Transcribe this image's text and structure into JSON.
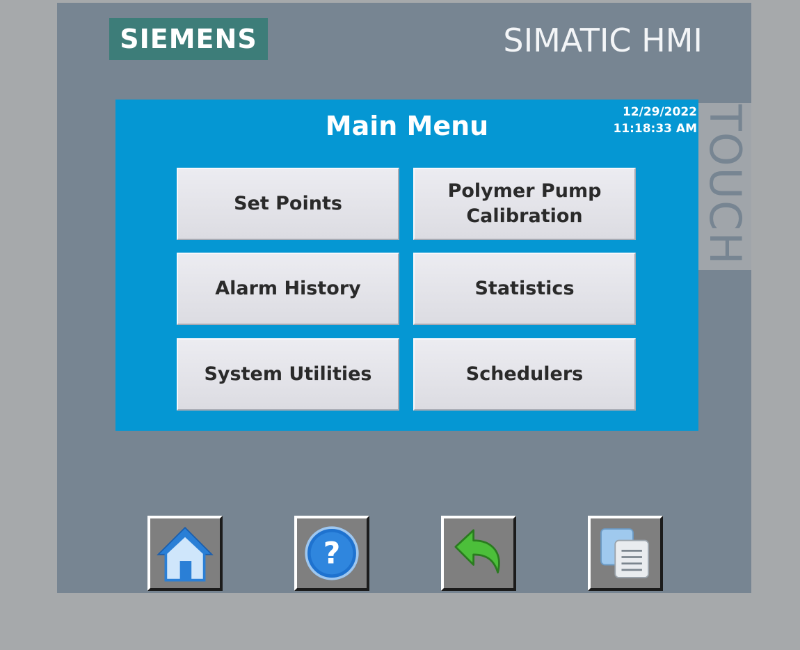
{
  "device": {
    "brand": "SIEMENS",
    "model": "SIMATIC HMI",
    "side_label": "TOUCH"
  },
  "screen": {
    "title": "Main Menu",
    "date": "12/29/2022",
    "time": "11:18:33 AM",
    "background_color": "#0597d3"
  },
  "menu": {
    "set_points": "Set Points",
    "polymer_pump_line1": "Polymer Pump",
    "polymer_pump_line2": "Calibration",
    "alarm_history": "Alarm History",
    "statistics": "Statistics",
    "system_utilities": "System Utilities",
    "schedulers": "Schedulers"
  },
  "nav_buttons": [
    {
      "icon": "home-icon"
    },
    {
      "icon": "help-icon"
    },
    {
      "icon": "back-arrow-icon"
    },
    {
      "icon": "screens-icon"
    }
  ],
  "colors": {
    "bezel": "#778592",
    "brand_logo": "#3d7d79",
    "button_face": "#e4e4e9"
  }
}
